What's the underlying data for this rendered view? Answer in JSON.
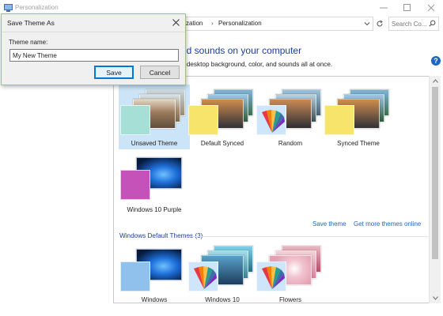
{
  "window": {
    "title": "Personalization"
  },
  "nav": {
    "breadcrumbs": [
      "alization",
      "Personalization"
    ],
    "search_placeholder": "Search Co..."
  },
  "main": {
    "heading": "nd sounds on your computer",
    "subtext": "e desktop background, color, and sounds all at once.",
    "help_glyph": "?",
    "my_themes": [
      {
        "label": "Unsaved Theme",
        "selected": true
      },
      {
        "label": "Default Synced",
        "selected": false
      },
      {
        "label": "Random",
        "selected": false
      },
      {
        "label": "Synced Theme",
        "selected": false
      },
      {
        "label": "Windows 10 Purple",
        "selected": false
      }
    ],
    "save_theme_link": "Save theme",
    "get_more_link": "Get more themes online",
    "default_group_label": "Windows Default Themes (3)",
    "default_themes": [
      {
        "label": "Windows"
      },
      {
        "label": "Windows 10"
      },
      {
        "label": "Flowers"
      }
    ]
  },
  "dialog": {
    "title": "Save Theme As",
    "name_label": "Theme name:",
    "name_value": "My New Theme",
    "save_label": "Save",
    "cancel_label": "Cancel"
  },
  "colors": {
    "accent": "#0078d7",
    "heading_blue": "#1a3e9c",
    "link_blue": "#1f66c3",
    "selection": "#cce4f7"
  }
}
